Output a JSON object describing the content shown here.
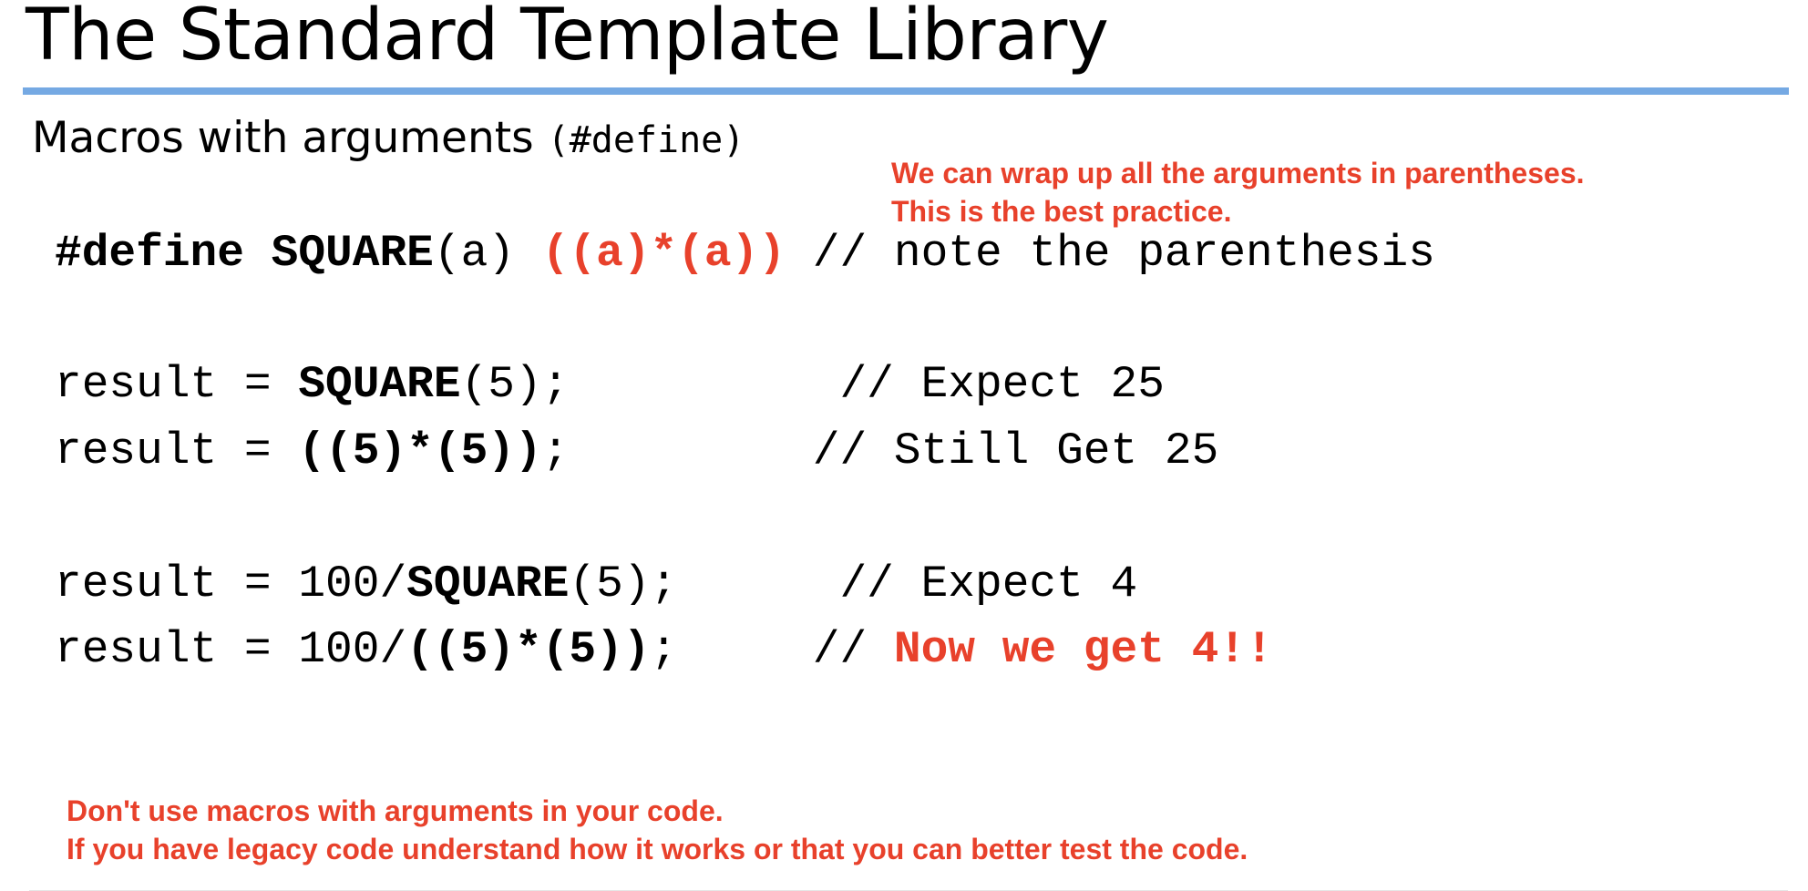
{
  "slide": {
    "title": "The Standard Template Library",
    "subtitle_text": "Macros with arguments",
    "subtitle_code": "(#define)",
    "accent_color": "#e8412b",
    "rule_color": "#75a9e3"
  },
  "notes": {
    "top": [
      "We can wrap up all the arguments in parentheses.",
      "This is the best practice."
    ],
    "bottom": [
      "Don't use macros with arguments in your code.",
      "If you have legacy code understand how it works or that you can better test the code."
    ]
  },
  "code": [
    {
      "segments": [
        {
          "text": "#define SQUARE",
          "style": "bold"
        },
        {
          "text": "(a) ",
          "style": "plain"
        },
        {
          "text": "((a)*(a))",
          "style": "accent-bold"
        },
        {
          "text": " // note the parenthesis",
          "style": "plain"
        }
      ]
    },
    {
      "segments": [
        {
          "text": "result = ",
          "style": "plain"
        },
        {
          "text": "SQUARE",
          "style": "bold"
        },
        {
          "text": "(5);",
          "style": "plain"
        },
        {
          "text": "          // Expect 25",
          "style": "plain"
        }
      ]
    },
    {
      "segments": [
        {
          "text": "result = ",
          "style": "plain"
        },
        {
          "text": "((5)*(5))",
          "style": "bold"
        },
        {
          "text": ";",
          "style": "plain"
        },
        {
          "text": "         // Still Get 25",
          "style": "plain"
        }
      ]
    },
    {
      "segments": [
        {
          "text": "result = 100/",
          "style": "plain"
        },
        {
          "text": "SQUARE",
          "style": "bold"
        },
        {
          "text": "(5);",
          "style": "plain"
        },
        {
          "text": "      // Expect 4",
          "style": "plain"
        }
      ]
    },
    {
      "segments": [
        {
          "text": "result = 100/",
          "style": "plain"
        },
        {
          "text": "((5)*(5))",
          "style": "bold"
        },
        {
          "text": ";",
          "style": "plain"
        },
        {
          "text": "     // ",
          "style": "plain"
        },
        {
          "text": "Now we get 4!!",
          "style": "accent-bold"
        }
      ]
    }
  ]
}
